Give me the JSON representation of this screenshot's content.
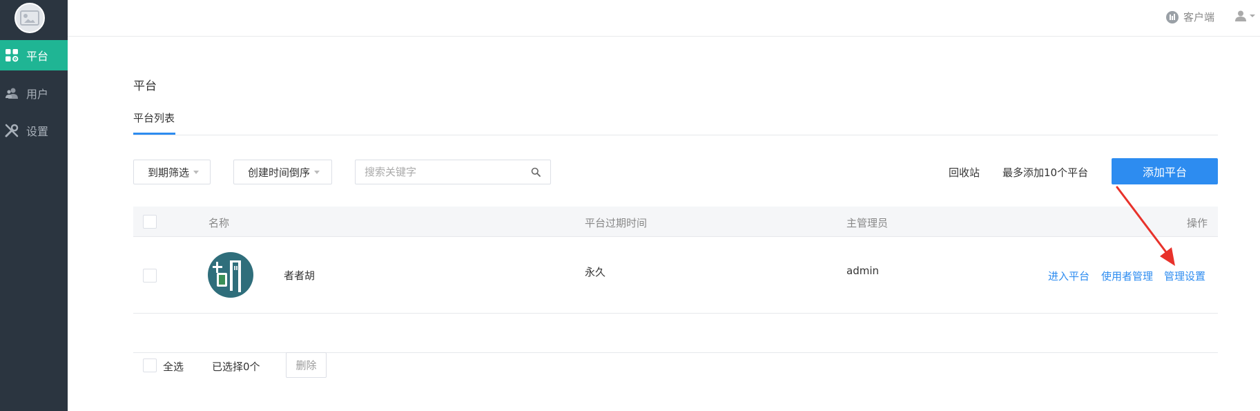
{
  "sidebar": {
    "items": [
      {
        "label": "平台",
        "icon": "grid-gear-icon",
        "active": true
      },
      {
        "label": "用户",
        "icon": "users-icon",
        "active": false
      },
      {
        "label": "设置",
        "icon": "wrench-icon",
        "active": false
      }
    ]
  },
  "topbar": {
    "client_label": "客户端",
    "client_icon": "client-icon",
    "user_icon": "user-icon"
  },
  "page": {
    "title": "平台",
    "tab": "平台列表"
  },
  "toolbar": {
    "expiry_filter": "到期筛选",
    "sort": "创建时间倒序",
    "search_placeholder": "搜索关键字",
    "recycle": "回收站",
    "limit_note": "最多添加10个平台",
    "add_button": "添加平台"
  },
  "table": {
    "columns": [
      "名称",
      "平台过期时间",
      "主管理员",
      "操作"
    ],
    "rows": [
      {
        "name": "者者胡",
        "expiry": "永久",
        "admin": "admin",
        "actions": [
          "进入平台",
          "使用者管理",
          "管理设置"
        ]
      }
    ]
  },
  "footer": {
    "select_all": "全选",
    "selected_count": "已选择0个",
    "delete": "删除"
  },
  "colors": {
    "sidebar": "#2b3540",
    "active": "#1fb594",
    "primary": "#2d8cf0",
    "annotation": "#e8322b"
  }
}
